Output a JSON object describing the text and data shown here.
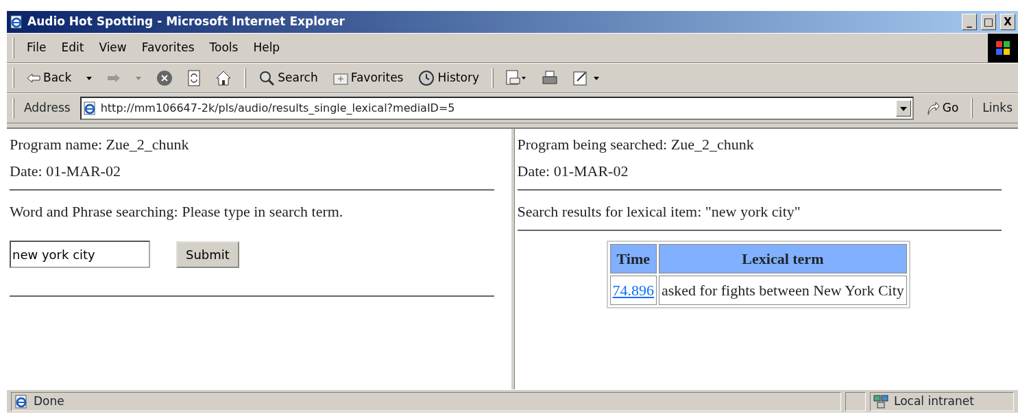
{
  "window": {
    "title": "Audio Hot Spotting - Microsoft Internet Explorer",
    "controls": [
      "_",
      "□",
      "X"
    ]
  },
  "menu": [
    "File",
    "Edit",
    "View",
    "Favorites",
    "Tools",
    "Help"
  ],
  "toolbar": {
    "back": "Back",
    "search": "Search",
    "favorites": "Favorites",
    "history": "History"
  },
  "address": {
    "label": "Address",
    "url": "http://mm106647-2k/pls/audio/results_single_lexical?mediaID=5",
    "go": "Go",
    "links": "Links"
  },
  "left_frame": {
    "program": "Program name: Zue_2_chunk",
    "date": "Date: 01-MAR-02",
    "prompt": "Word and Phrase searching: Please type in search term.",
    "search_value": "new york city",
    "submit": "Submit"
  },
  "right_frame": {
    "program": "Program being searched: Zue_2_chunk",
    "date": "Date: 01-MAR-02",
    "heading": "Search results for lexical item: \"new york city\"",
    "table": {
      "columns": [
        "Time",
        "Lexical term"
      ],
      "rows": [
        {
          "time": "74.896",
          "term": "asked for fights between New York City"
        }
      ]
    }
  },
  "status_bar": {
    "text": "Done",
    "zone": "Local intranet"
  }
}
